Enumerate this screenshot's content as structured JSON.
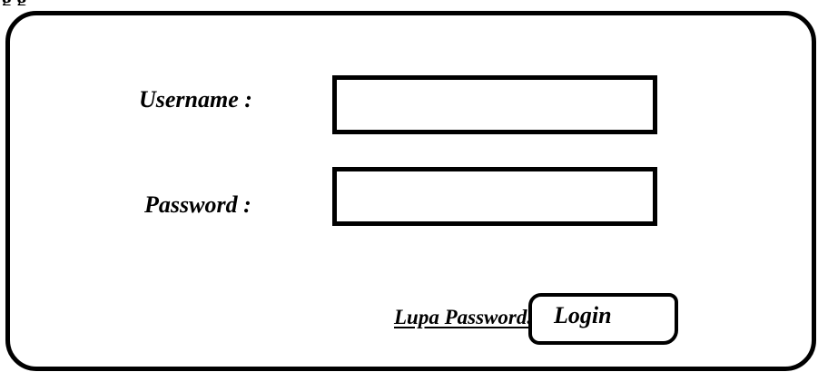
{
  "form": {
    "caption": "g                                   g",
    "username_label": "Username :",
    "username_value": "",
    "password_label": "Password :",
    "password_value": "",
    "forgot_password_link": "Lupa Password.?",
    "login_button_label": "Login"
  }
}
